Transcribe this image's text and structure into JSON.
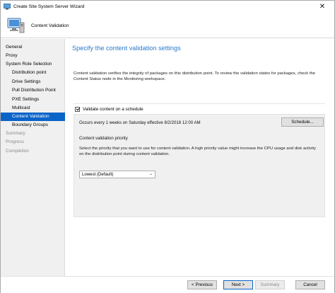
{
  "window": {
    "title": "Create Site System Server Wizard"
  },
  "header": {
    "page_name": "Content Validation"
  },
  "nav": {
    "items": [
      {
        "label": "General",
        "level": "top",
        "state": "normal"
      },
      {
        "label": "Proxy",
        "level": "top",
        "state": "normal"
      },
      {
        "label": "System Role Selection",
        "level": "top",
        "state": "normal"
      },
      {
        "label": "Distribution point",
        "level": "sub",
        "state": "normal"
      },
      {
        "label": "Drive Settings",
        "level": "sub",
        "state": "normal"
      },
      {
        "label": "Pull Distribution Point",
        "level": "sub",
        "state": "normal"
      },
      {
        "label": "PXE Settings",
        "level": "sub",
        "state": "normal"
      },
      {
        "label": "Multicast",
        "level": "sub",
        "state": "normal"
      },
      {
        "label": "Content Validation",
        "level": "sub",
        "state": "active"
      },
      {
        "label": "Boundary Groups",
        "level": "sub",
        "state": "normal"
      },
      {
        "label": "Summary",
        "level": "top",
        "state": "disabled"
      },
      {
        "label": "Progress",
        "level": "top",
        "state": "disabled"
      },
      {
        "label": "Completion",
        "level": "top",
        "state": "disabled"
      }
    ]
  },
  "main": {
    "heading": "Specify the content validation settings",
    "description": "Content validation verifies the integrity of packages on this distribution point. To review the validation states for packages, check the Content Status node in the Monitoring workspace.",
    "validate_checkbox": {
      "label": "Validate content on a schedule",
      "checked": true
    },
    "schedule_text": "Occurs every 1 weeks on Saturday effective 8/2/2018 12:00 AM",
    "schedule_button": "Schedule...",
    "priority_title": "Content validation priority",
    "priority_description": "Select the priority that you want to use for content validation. A high priority value might increase the CPU usage and disk activity on the distribution point during content validation.",
    "priority_select": {
      "value": "Lowest (Default)"
    }
  },
  "footer": {
    "previous": "< Previous",
    "next": "Next >",
    "summary": "Summary",
    "cancel": "Cancel"
  },
  "colors": {
    "accent": "#0a64c8",
    "heading": "#2b79c8",
    "nav_bg": "#f0f0f0"
  },
  "icons": {
    "app": "computer-icon",
    "header": "computer-monitor-icon",
    "close": "close-icon",
    "dropdown": "chevron-down-icon"
  }
}
